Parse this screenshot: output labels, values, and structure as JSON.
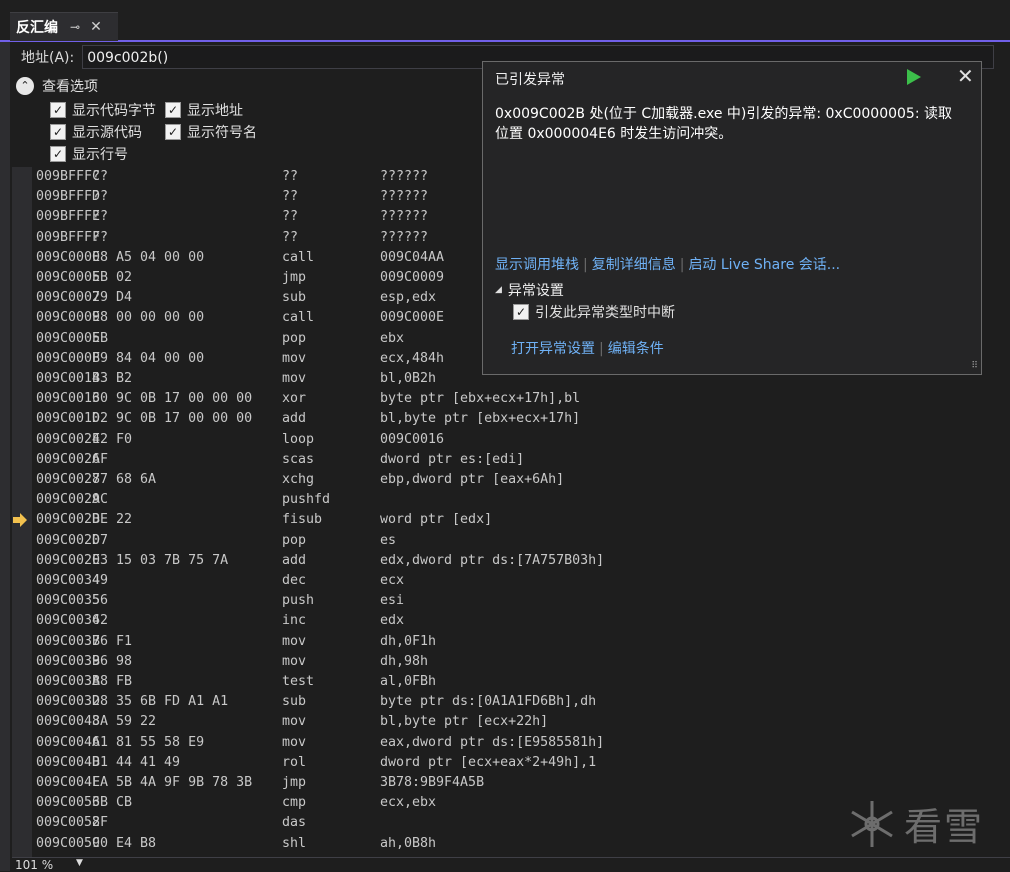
{
  "tab": {
    "title": "反汇编",
    "pin_icon": "pin-icon",
    "close_icon": "close-icon"
  },
  "address": {
    "label": "地址(A):",
    "value": "009c002b()"
  },
  "view_options": {
    "title": "查看选项",
    "checkboxes": [
      {
        "label": "显示代码字节",
        "checked": true
      },
      {
        "label": "显示地址",
        "checked": true
      },
      {
        "label": "显示源代码",
        "checked": true
      },
      {
        "label": "显示符号名",
        "checked": true
      },
      {
        "label": "显示行号",
        "checked": true
      }
    ]
  },
  "disassembly": [
    {
      "addr": "009BFFFC",
      "bytes": "??",
      "mnemonic": "??",
      "operand": "??????"
    },
    {
      "addr": "009BFFFD",
      "bytes": "??",
      "mnemonic": "??",
      "operand": "??????"
    },
    {
      "addr": "009BFFFE",
      "bytes": "??",
      "mnemonic": "??",
      "operand": "??????"
    },
    {
      "addr": "009BFFFF",
      "bytes": "??",
      "mnemonic": "??",
      "operand": "??????"
    },
    {
      "addr": "009C0000",
      "bytes": "E8 A5 04 00 00",
      "mnemonic": "call",
      "operand": "009C04AA"
    },
    {
      "addr": "009C0005",
      "bytes": "EB 02",
      "mnemonic": "jmp",
      "operand": "009C0009"
    },
    {
      "addr": "009C0007",
      "bytes": "29 D4",
      "mnemonic": "sub",
      "operand": "esp,edx"
    },
    {
      "addr": "009C0009",
      "bytes": "E8 00 00 00 00",
      "mnemonic": "call",
      "operand": "009C000E"
    },
    {
      "addr": "009C000E",
      "bytes": "5B",
      "mnemonic": "pop",
      "operand": "ebx"
    },
    {
      "addr": "009C000F",
      "bytes": "B9 84 04 00 00",
      "mnemonic": "mov",
      "operand": "ecx,484h"
    },
    {
      "addr": "009C0014",
      "bytes": "B3 B2",
      "mnemonic": "mov",
      "operand": "bl,0B2h"
    },
    {
      "addr": "009C0016",
      "bytes": "30 9C 0B 17 00 00 00",
      "mnemonic": "xor",
      "operand": "byte ptr [ebx+ecx+17h],bl"
    },
    {
      "addr": "009C001D",
      "bytes": "02 9C 0B 17 00 00 00",
      "mnemonic": "add",
      "operand": "bl,byte ptr [ebx+ecx+17h]"
    },
    {
      "addr": "009C0024",
      "bytes": "E2 F0",
      "mnemonic": "loop",
      "operand": "009C0016"
    },
    {
      "addr": "009C0026",
      "bytes": "AF",
      "mnemonic": "scas",
      "operand": "dword ptr es:[edi]"
    },
    {
      "addr": "009C0027",
      "bytes": "87 68 6A",
      "mnemonic": "xchg",
      "operand": "ebp,dword ptr [eax+6Ah]"
    },
    {
      "addr": "009C002A",
      "bytes": "9C",
      "mnemonic": "pushfd",
      "operand": ""
    },
    {
      "addr": "009C002B",
      "bytes": "DE 22",
      "mnemonic": "fisub",
      "operand": "word ptr [edx]",
      "current": true
    },
    {
      "addr": "009C002D",
      "bytes": "07",
      "mnemonic": "pop",
      "operand": "es"
    },
    {
      "addr": "009C002E",
      "bytes": "03 15 03 7B 75 7A",
      "mnemonic": "add",
      "operand": "edx,dword ptr ds:[7A757B03h]"
    },
    {
      "addr": "009C0034",
      "bytes": "49",
      "mnemonic": "dec",
      "operand": "ecx"
    },
    {
      "addr": "009C0035",
      "bytes": "56",
      "mnemonic": "push",
      "operand": "esi"
    },
    {
      "addr": "009C0036",
      "bytes": "42",
      "mnemonic": "inc",
      "operand": "edx"
    },
    {
      "addr": "009C0037",
      "bytes": "B6 F1",
      "mnemonic": "mov",
      "operand": "dh,0F1h"
    },
    {
      "addr": "009C0039",
      "bytes": "B6 98",
      "mnemonic": "mov",
      "operand": "dh,98h"
    },
    {
      "addr": "009C003B",
      "bytes": "A8 FB",
      "mnemonic": "test",
      "operand": "al,0FBh"
    },
    {
      "addr": "009C003D",
      "bytes": "28 35 6B FD A1 A1",
      "mnemonic": "sub",
      "operand": "byte ptr ds:[0A1A1FD6Bh],dh"
    },
    {
      "addr": "009C0043",
      "bytes": "8A 59 22",
      "mnemonic": "mov",
      "operand": "bl,byte ptr [ecx+22h]"
    },
    {
      "addr": "009C0046",
      "bytes": "A1 81 55 58 E9",
      "mnemonic": "mov",
      "operand": "eax,dword ptr ds:[E9585581h]"
    },
    {
      "addr": "009C004B",
      "bytes": "D1 44 41 49",
      "mnemonic": "rol",
      "operand": "dword ptr [ecx+eax*2+49h],1"
    },
    {
      "addr": "009C004F",
      "bytes": "EA 5B 4A 9F 9B 78 3B",
      "mnemonic": "jmp",
      "operand": "3B78:9B9F4A5B"
    },
    {
      "addr": "009C0056",
      "bytes": "3B CB",
      "mnemonic": "cmp",
      "operand": "ecx,ebx"
    },
    {
      "addr": "009C0058",
      "bytes": "2F",
      "mnemonic": "das",
      "operand": ""
    },
    {
      "addr": "009C0059",
      "bytes": "C0 E4 B8",
      "mnemonic": "shl",
      "operand": "ah,0B8h"
    }
  ],
  "exception_popup": {
    "title": "已引发异常",
    "message": "0x009C002B 处(位于 C加载器.exe 中)引发的异常: 0xC0000005: 读取位置 0x000004E6 时发生访问冲突。",
    "links": [
      "显示调用堆栈",
      "复制详细信息",
      "启动 Live Share 会话..."
    ],
    "settings_title": "异常设置",
    "break_checkbox": {
      "label": "引发此异常类型时中断",
      "checked": true
    },
    "settings_links": [
      "打开异常设置",
      "编辑条件"
    ],
    "continue_icon": "play-icon",
    "close_icon": "close-icon",
    "continue_color": "#3cbf4a"
  },
  "status": {
    "zoom": "101 %"
  },
  "watermark": {
    "text": "看雪",
    "icon": "snowflake-icon"
  },
  "colors": {
    "accent": "#7160e8",
    "link": "#6fb1f5",
    "current_arrow": "#f2c14e"
  }
}
